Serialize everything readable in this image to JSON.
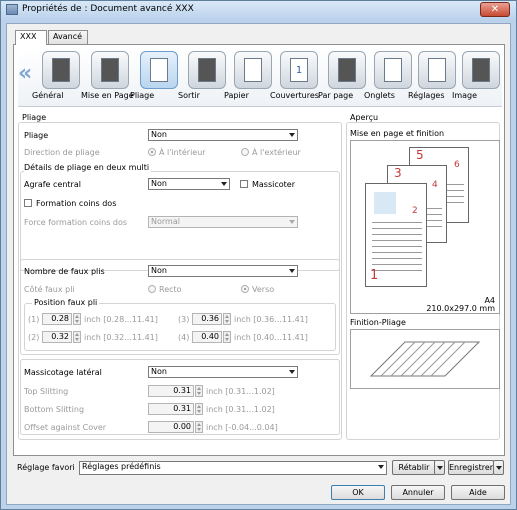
{
  "window": {
    "title": "Propriétés de : Document avancé XXX",
    "close_glyph": "✕"
  },
  "tabs": [
    {
      "label": "XXX"
    },
    {
      "label": "Avancé"
    }
  ],
  "toolbar": {
    "prev_arrow": "«",
    "next_arrow": "»",
    "items": [
      {
        "label": "Général",
        "icon": "printer-icon"
      },
      {
        "label": "Mise en Page",
        "icon": "layout-icon"
      },
      {
        "label": "Pliage",
        "icon": "fold-icon"
      },
      {
        "label": "Sortir",
        "icon": "output-icon"
      },
      {
        "label": "Papier",
        "icon": "paper-icon"
      },
      {
        "label": "Couvertures",
        "icon": "cover-icon",
        "glyph": "1"
      },
      {
        "label": "Par page",
        "icon": "per-page-icon"
      },
      {
        "label": "Onglets",
        "icon": "tabs-icon"
      },
      {
        "label": "Réglages",
        "icon": "settings-icon"
      },
      {
        "label": "Image",
        "icon": "image-icon"
      }
    ]
  },
  "pliage": {
    "title": "Pliage",
    "pliage_label": "Pliage",
    "pliage_value": "Non",
    "direction_label": "Direction de pliage",
    "direction_in": "À l'intérieur",
    "direction_out": "À l'extérieur",
    "deux_multi_label": "Détails de pliage en deux multi",
    "agrafe_label": "Agrafe central",
    "agrafe_value": "Non",
    "massicoter_label": "Massicoter",
    "formation_label": "Formation coins dos",
    "force_label": "Force formation coins dos",
    "force_value": "Normal",
    "faux_plis_label": "Nombre de faux plis",
    "faux_plis_value": "Non",
    "cote_label": "Côté faux pli",
    "recto_label": "Recto",
    "verso_label": "Verso",
    "position_label": "Position faux pli",
    "positions": [
      {
        "idx": "(1)",
        "value": "0.28",
        "range": "inch [0.28...11.41]"
      },
      {
        "idx": "(2)",
        "value": "0.32",
        "range": "inch [0.32...11.41]"
      },
      {
        "idx": "(3)",
        "value": "0.36",
        "range": "inch [0.36...11.41]"
      },
      {
        "idx": "(4)",
        "value": "0.40",
        "range": "inch [0.40...11.41]"
      }
    ],
    "massicotage_label": "Massicotage latéral",
    "massicotage_value": "Non",
    "slits": [
      {
        "label": "Top Slitting",
        "value": "0.31",
        "range": "inch [0.31...1.02]"
      },
      {
        "label": "Bottom Slitting",
        "value": "0.31",
        "range": "inch [0.31...1.02]"
      },
      {
        "label": "Offset against Cover",
        "value": "0.00",
        "range": "inch [-0.04...0.04]"
      }
    ]
  },
  "apercu": {
    "title": "Aperçu",
    "mise_label": "Mise en page et finition",
    "paper_size": "A4",
    "paper_dims": "210.0x297.0 mm",
    "finition_label": "Finition-Pliage",
    "page_numbers": [
      "1",
      "2",
      "3",
      "4",
      "5",
      "6"
    ]
  },
  "favorite": {
    "label": "Réglage favori",
    "value": "Réglages prédéfinis",
    "restore": "Rétablir",
    "save": "Enregistrer"
  },
  "buttons": {
    "ok": "OK",
    "cancel": "Annuler",
    "help": "Aide"
  },
  "colors": {
    "accent": "#c23b3b",
    "frame": "#bcd2ea"
  }
}
